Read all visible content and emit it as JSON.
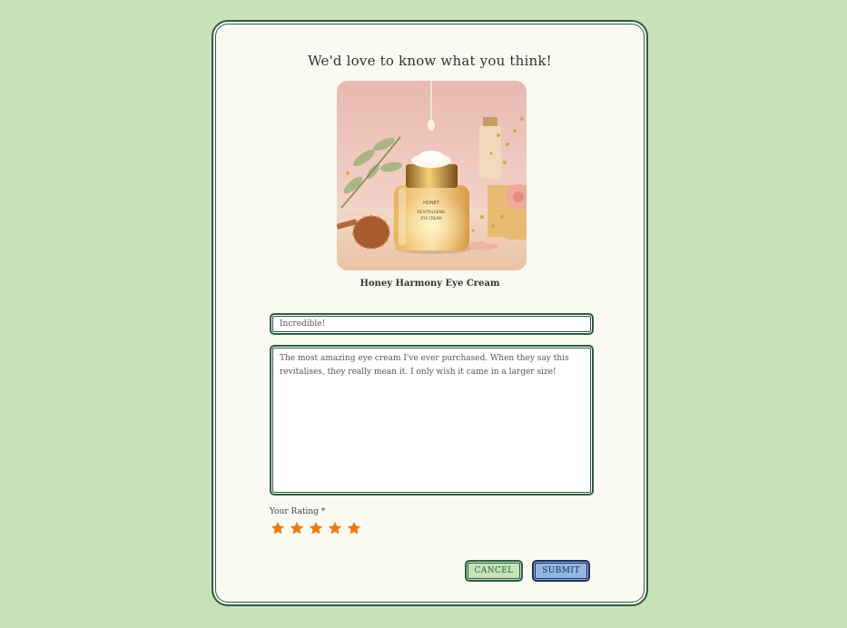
{
  "review_form": {
    "heading": "We'd love to know what you think!",
    "product": {
      "name": "Honey Harmony Eye Cream",
      "jar_label_line1": "HONEY",
      "jar_label_line2": "REVITALISING",
      "jar_label_line3": "EYE CREAM"
    },
    "title_field": {
      "value": "Incredible!"
    },
    "review_field": {
      "value": "The most amazing eye cream I've ever purchased. When they say this revitalises, they really mean it. I only wish it came in a larger size!"
    },
    "rating": {
      "label": "Your Rating *",
      "value": 5,
      "max": 5,
      "star_icon": "star-icon",
      "star_color": "#f07a12"
    },
    "buttons": {
      "cancel_label": "CANCEL",
      "submit_label": "SUBMIT"
    },
    "colors": {
      "page_background": "#c6e3b8",
      "card_background": "#fbfaf2",
      "border": "#2f5c45",
      "cancel_background": "#c6e3b8",
      "submit_background": "#92b7e2",
      "submit_border": "#1e2e55"
    }
  }
}
